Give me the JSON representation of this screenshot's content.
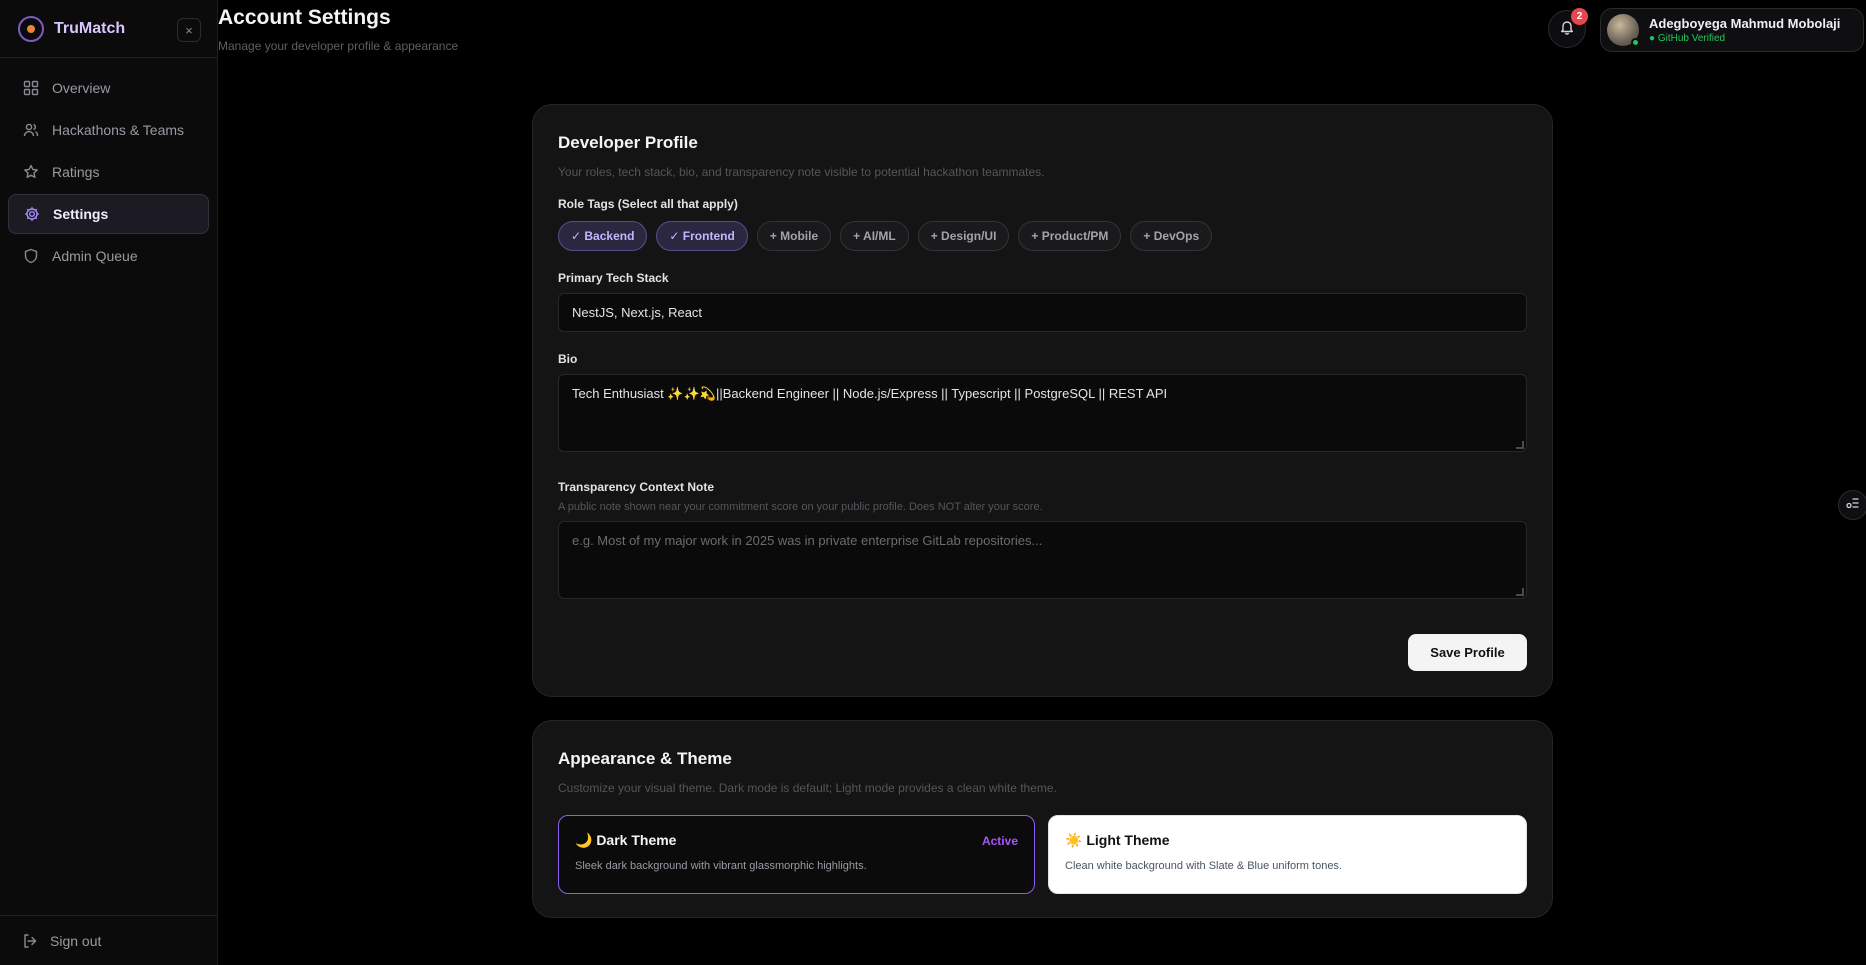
{
  "brand": {
    "name": "TruMatch",
    "close_glyph": "×"
  },
  "sidebar": {
    "items": [
      {
        "label": "Overview",
        "icon": "grid-icon"
      },
      {
        "label": "Hackathons & Teams",
        "icon": "users-icon"
      },
      {
        "label": "Ratings",
        "icon": "star-icon"
      },
      {
        "label": "Settings",
        "icon": "gear-icon",
        "active": true
      },
      {
        "label": "Admin Queue",
        "icon": "shield-icon"
      }
    ],
    "signout_label": "Sign out"
  },
  "header": {
    "title": "Account Settings",
    "subtitle": "Manage your developer profile & appearance",
    "notification_count": "2",
    "user_name": "Adegboyega Mahmud Mobolaji",
    "user_status": "● GitHub Verified"
  },
  "profile": {
    "title": "Developer Profile",
    "description": "Your roles, tech stack, bio, and transparency note visible to potential hackathon teammates.",
    "roles_label": "Role Tags (Select all that apply)",
    "roles": [
      {
        "label": "✓ Backend",
        "selected": true
      },
      {
        "label": "✓ Frontend",
        "selected": true
      },
      {
        "label": "+ Mobile",
        "selected": false
      },
      {
        "label": "+ AI/ML",
        "selected": false
      },
      {
        "label": "+ Design/UI",
        "selected": false
      },
      {
        "label": "+ Product/PM",
        "selected": false
      },
      {
        "label": "+ DevOps",
        "selected": false
      }
    ],
    "stack_label": "Primary Tech Stack",
    "stack_value": "NestJS, Next.js, React",
    "bio_label": "Bio",
    "bio_value": "Tech Enthusiast ✨✨💫||Backend Engineer || Node.js/Express || Typescript || PostgreSQL || REST API",
    "note_label": "Transparency Context Note",
    "note_hint": "A public note shown near your commitment score on your public profile. Does NOT alter your score.",
    "note_placeholder": "e.g. Most of my major work in 2025 was in private enterprise GitLab repositories...",
    "save_label": "Save Profile"
  },
  "appearance": {
    "title": "Appearance & Theme",
    "description": "Customize your visual theme. Dark mode is default; Light mode provides a clean white theme.",
    "dark": {
      "name": "🌙 Dark Theme",
      "badge": "Active",
      "desc": "Sleek dark background with vibrant glassmorphic highlights."
    },
    "light": {
      "name": "☀️ Light Theme",
      "desc": "Clean white background with Slate & Blue uniform tones."
    }
  },
  "colors": {
    "accent": "#8b5cf6",
    "verified": "#22c55e",
    "badge": "#e5484d"
  }
}
